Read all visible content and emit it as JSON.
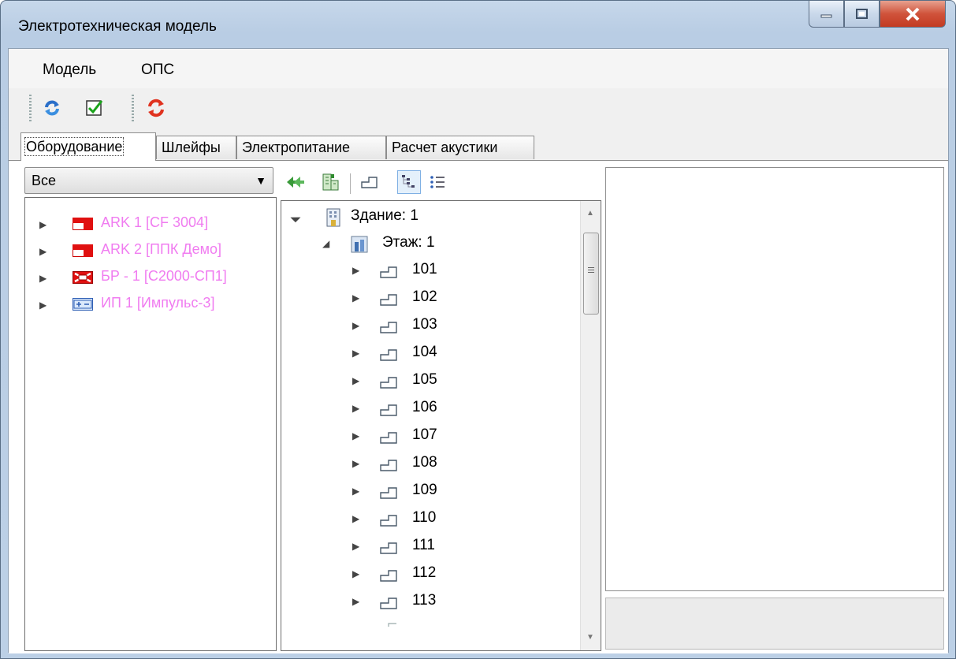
{
  "window": {
    "title": "Электротехническая модель"
  },
  "menu": {
    "items": [
      "Модель",
      "ОПС"
    ]
  },
  "toolbar": {
    "buttons": [
      "refresh-icon",
      "checkbox-checked-icon",
      "sync-red-icon"
    ]
  },
  "tabs": [
    {
      "label": "Оборудование",
      "active": true
    },
    {
      "label": "Шлейфы",
      "active": false
    },
    {
      "label": "Электропитание",
      "active": false
    },
    {
      "label": "Расчет акустики",
      "active": false
    }
  ],
  "filter": {
    "selected": "Все"
  },
  "devices": [
    {
      "label": "ARK 1 [CF 3004]",
      "icon": "panel-red-icon"
    },
    {
      "label": "ARK 2 [ППК Демо]",
      "icon": "panel-red-icon"
    },
    {
      "label": "БР - 1 [С2000-СП1]",
      "icon": "relay-block-icon"
    },
    {
      "label": "ИП 1 [Импульс-3]",
      "icon": "power-supply-icon"
    }
  ],
  "colors": {
    "device_text": "#f07cf0",
    "accent": "#3399ff",
    "close_button": "#c8452d"
  },
  "tree": {
    "building": "Здание: 1",
    "floor": "Этаж: 1",
    "rooms": [
      "101",
      "102",
      "103",
      "104",
      "105",
      "106",
      "107",
      "108",
      "109",
      "110",
      "111",
      "112",
      "113"
    ]
  }
}
